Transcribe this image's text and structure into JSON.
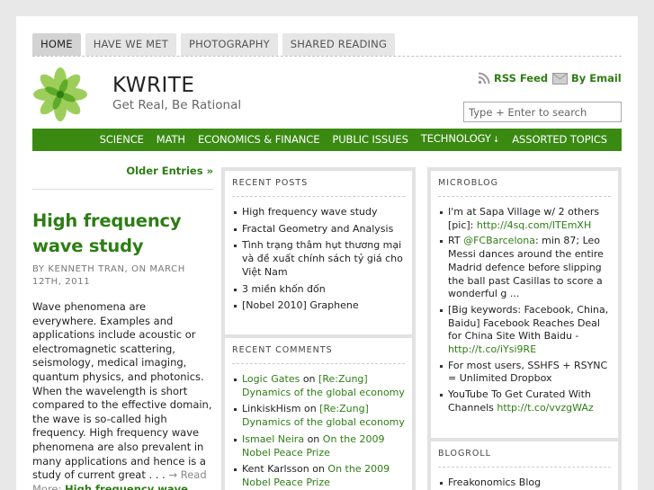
{
  "tabs": [
    "HOME",
    "HAVE WE MET",
    "PHOTOGRAPHY",
    "SHARED READING"
  ],
  "header": {
    "title": "KWRITE",
    "tagline": "Get Real, Be Rational",
    "rss_label": "RSS Feed",
    "email_label": "By Email",
    "search_placeholder": "Type + Enter to search"
  },
  "nav": [
    "SCIENCE",
    "MATH",
    "ECONOMICS & FINANCE",
    "PUBLIC ISSUES",
    "TECHNOLOGY",
    "ASSORTED TOPICS"
  ],
  "main": {
    "older_entries": "Older Entries »",
    "post": {
      "title": "High frequency wave study",
      "meta": "BY KENNETH TRAN, ON MARCH 12TH, 2011",
      "excerpt": "Wave phenomena are everywhere. Examples and applications include acoustic or electromagnetic scattering, seismology, medical imaging, quantum physics, and photonics. When the wavelength is short compared to the effective domain, the wave is so-called high frequency. High frequency wave phenomena are also prevalent in many applications and hence is a study of current great . . . ",
      "read_more": "→ Read More:",
      "read_more_title": "High frequency wave study"
    }
  },
  "recent_posts": {
    "title": "RECENT POSTS",
    "items": [
      "High frequency wave study",
      "Fractal Geometry and Analysis",
      "Tình trạng thâm hụt thương mại và đề xuất chính sách tỷ giá cho Việt Nam",
      "3 miền khốn đốn",
      "[Nobel 2010] Graphene"
    ]
  },
  "recent_comments": {
    "title": "RECENT COMMENTS",
    "items": [
      {
        "author": "Logic Gates",
        "on": " on ",
        "post": "[Re:Zung] Dynamics of the global economy"
      },
      {
        "author": "LinkiskHism",
        "on": " on ",
        "post": "[Re:Zung] Dynamics of the global economy"
      },
      {
        "author": "Ismael Neira",
        "on": " on ",
        "post": "On the 2009 Nobel Peace Prize"
      },
      {
        "author": "Kent Karlsson",
        "on": " on ",
        "post": "On the 2009 Nobel Peace Prize"
      }
    ]
  },
  "microblog": {
    "title": "MICROBLOG",
    "items": [
      {
        "text": "I'm at Sapa Village w/ 2 others [pic]: ",
        "link": "http://4sq.com/lTEmXH",
        "tail": ""
      },
      {
        "text": "RT ",
        "link": "@FCBarcelona",
        "tail": ": min 87; Leo Messi dances around the entire Madrid defence before slipping the ball past Casillas to score a wonderful g ..."
      },
      {
        "text": "[Big keywords: Facebook, China, Baidu] Facebook Reaches Deal for China Site With Baidu - ",
        "link": "http://t.co/iYsi9RE",
        "tail": ""
      },
      {
        "text": "For most users, SSHFS + RSYNC = Unlimited Dropbox",
        "link": "",
        "tail": ""
      },
      {
        "text": "YouTube To Get Curated With Channels ",
        "link": "http://t.co/vvzgWAz",
        "tail": ""
      }
    ]
  },
  "blogroll": {
    "title": "BLOGROLL",
    "items": [
      "Freakonomics Blog"
    ]
  },
  "colors": {
    "accent": "#3a8a12",
    "link": "#2e7d14"
  }
}
